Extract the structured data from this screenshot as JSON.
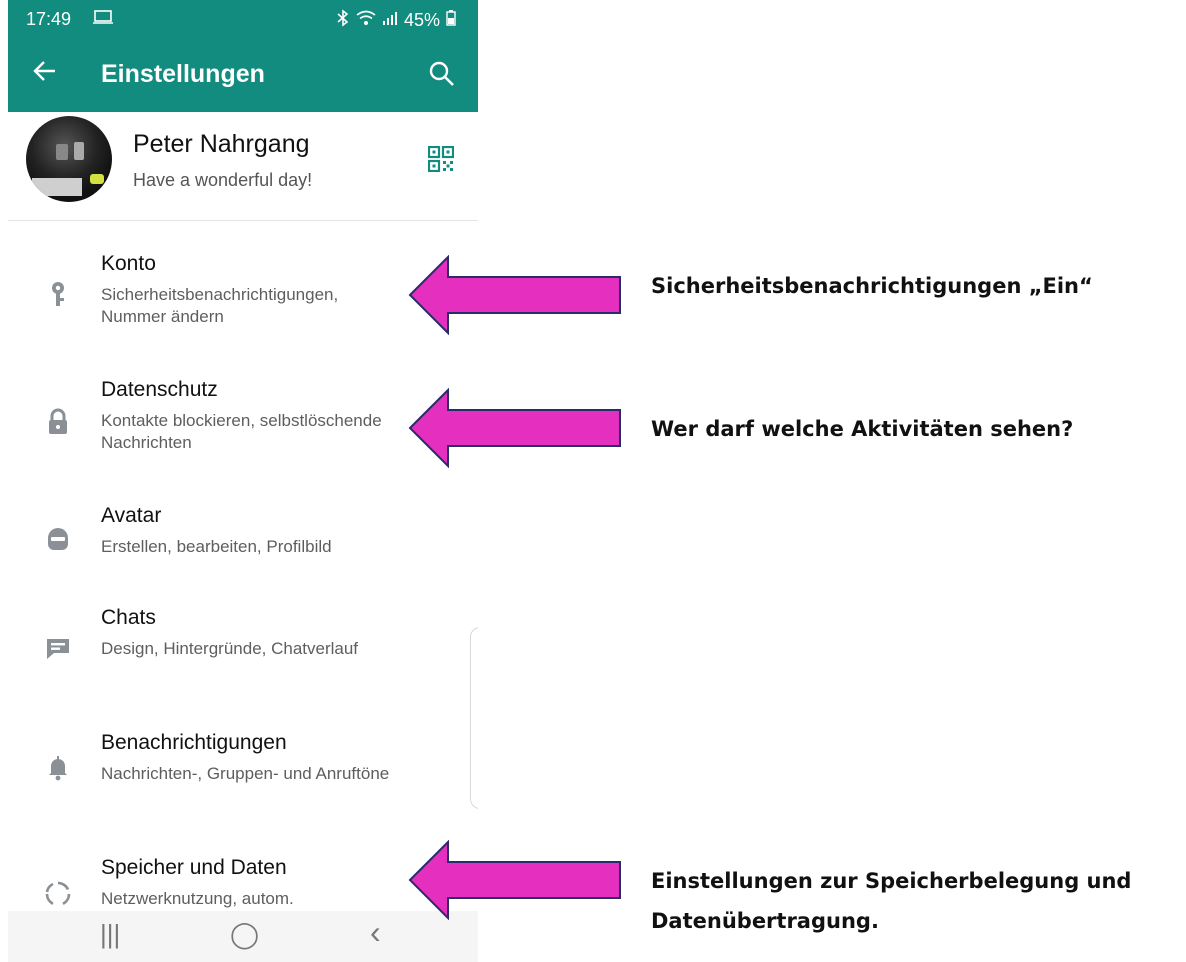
{
  "status_bar": {
    "time": "17:49",
    "battery": "45%"
  },
  "app_bar": {
    "title": "Einstellungen"
  },
  "profile": {
    "name": "Peter Nahrgang",
    "status": "Have a wonderful day!"
  },
  "settings": [
    {
      "label": "Konto",
      "sub": "Sicherheitsbenachrichtigungen, Nummer ändern",
      "icon": "key-icon"
    },
    {
      "label": "Datenschutz",
      "sub": "Kontakte blockieren, selbstlöschende Nachrichten",
      "icon": "lock-icon"
    },
    {
      "label": "Avatar",
      "sub": "Erstellen, bearbeiten, Profilbild",
      "icon": "avatar-icon"
    },
    {
      "label": "Chats",
      "sub": "Design, Hintergründe, Chatverlauf",
      "icon": "chat-icon"
    },
    {
      "label": "Benachrichtigungen",
      "sub": "Nachrichten-, Gruppen- und Anruftöne",
      "icon": "bell-icon"
    },
    {
      "label": "Speicher und Daten",
      "sub": "Netzwerknutzung, autom.",
      "icon": "storage-icon"
    }
  ],
  "annotations": {
    "konto": "Sicherheitsbenachrichtigungen „Ein“",
    "datenschutz": "Wer darf welche Aktivitäten sehen?",
    "speicher_line1": "Einstellungen zur Speicherbelegung und",
    "speicher_line2": "Datenübertragung."
  },
  "colors": {
    "header": "#128c7e",
    "icon": "#8a9096",
    "arrow_fill": "#e42fbf",
    "arrow_stroke": "#2b2b6b"
  },
  "navbar": {
    "recents": "|||",
    "home": "◯",
    "back": "‹"
  }
}
